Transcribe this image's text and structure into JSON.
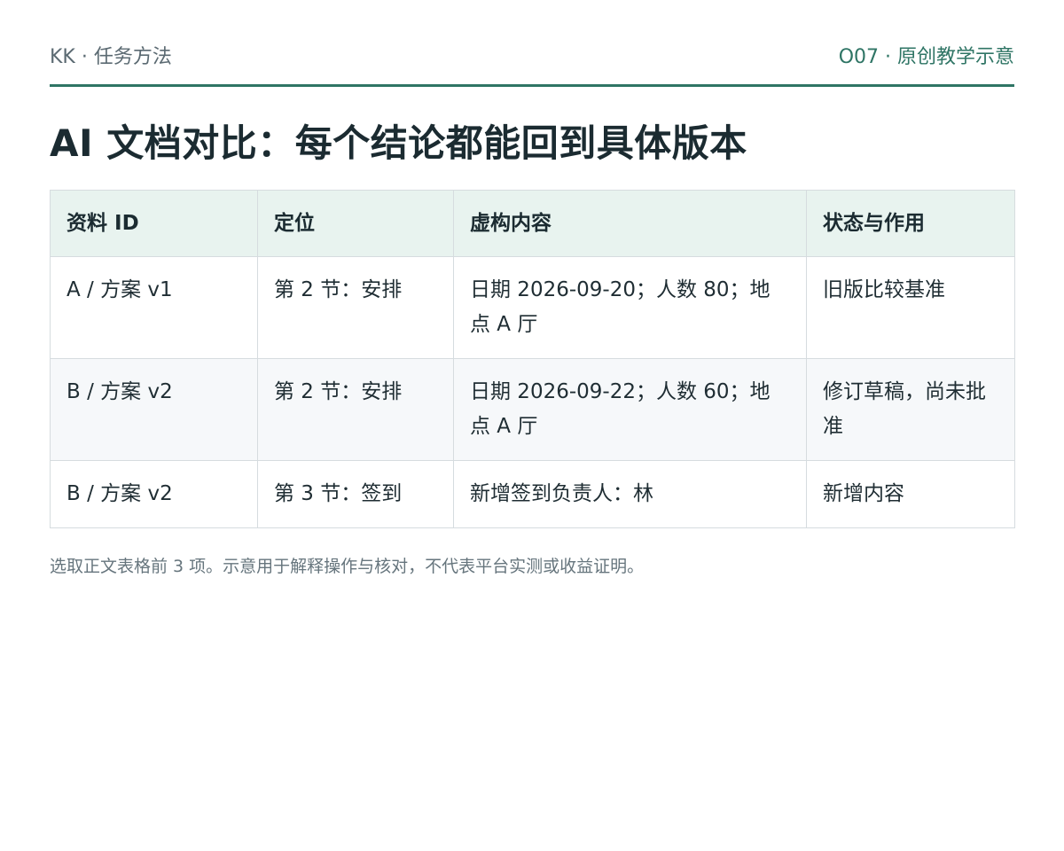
{
  "header": {
    "brand": "KK · 任务方法",
    "series": "O07 · 原创教学示意"
  },
  "title": "AI 文档对比：每个结论都能回到具体版本",
  "table": {
    "columns": [
      "资料 ID",
      "定位",
      "虚构内容",
      "状态与作用"
    ],
    "rows": [
      [
        "A / 方案 v1",
        "第 2 节：安排",
        "日期 2026-09-20；人数 80；地点 A 厅",
        "旧版比较基准"
      ],
      [
        "B / 方案 v2",
        "第 2 节：安排",
        "日期 2026-09-22；人数 60；地点 A 厅",
        "修订草稿，尚未批准"
      ],
      [
        "B / 方案 v2",
        "第 3 节：签到",
        "新增签到负责人：林",
        "新增内容"
      ]
    ]
  },
  "footnote": "选取正文表格前 3 项。示意用于解释操作与核对，不代表平台实测或收益证明。"
}
